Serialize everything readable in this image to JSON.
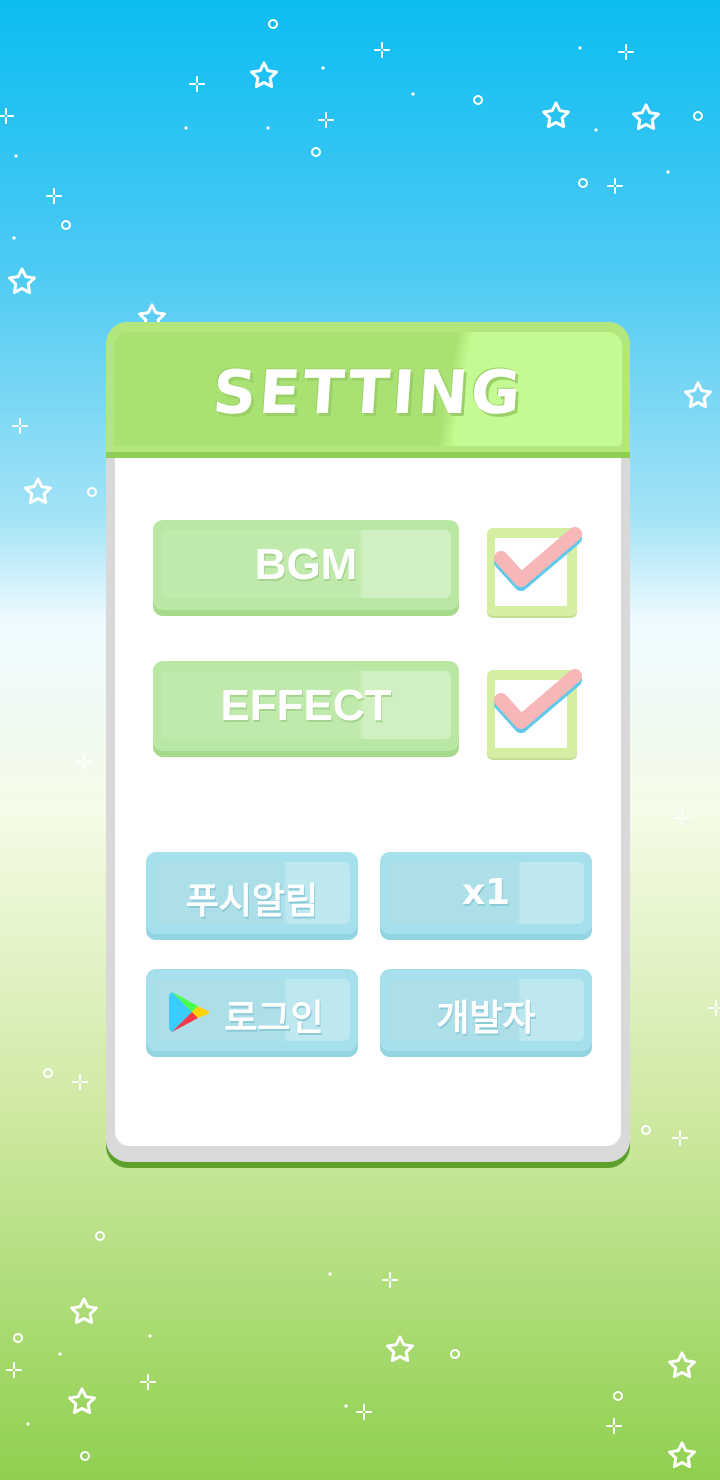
{
  "dialog": {
    "title": "SETTING",
    "colors": {
      "header": "#b3e67d",
      "header_highlight": "#c3fb92",
      "panel_border": "#5da02a",
      "panel_bg": "#ffffff"
    }
  },
  "audio": {
    "bgm": {
      "label": "BGM",
      "checked": true
    },
    "effect": {
      "label": "EFFECT",
      "checked": true
    }
  },
  "buttons": {
    "push_alarm": {
      "label": "푸시알림"
    },
    "speed": {
      "label": "x1"
    },
    "login": {
      "label": "로그인",
      "icon": "google-play-icon"
    },
    "developer": {
      "label": "개발자"
    }
  },
  "colors": {
    "green_button": "#b9e8a4",
    "blue_button": "#a6e0ec",
    "check_mark": "#f7b6b8",
    "check_mark_shadow": "#5ec9e8"
  }
}
